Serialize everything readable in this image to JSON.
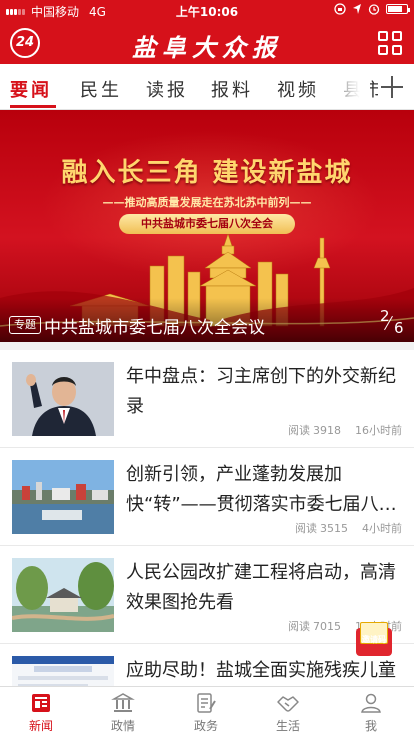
{
  "status_bar": {
    "carrier": "中国移动",
    "network": "4G",
    "time": "上午10:06"
  },
  "header": {
    "logo_text": "24",
    "app_title": "盐阜大众报"
  },
  "tabs": [
    {
      "label": "要闻",
      "active": true
    },
    {
      "label": "民生",
      "active": false
    },
    {
      "label": "读报",
      "active": false
    },
    {
      "label": "报料",
      "active": false
    },
    {
      "label": "视频",
      "active": false
    },
    {
      "label": "县市",
      "active": false
    }
  ],
  "banner": {
    "headline": "融入长三角 建设新盐城",
    "subline": "——推动高质量发展走在苏北苏中前列——",
    "pill": "中共盐城市委七届八次全会",
    "tag": "专题",
    "caption": "中共盐城市委七届八次全会议",
    "page_current": "2",
    "page_total": "6"
  },
  "news": [
    {
      "headline": "年中盘点：习主席创下的外交新纪录",
      "reads_label": "阅读",
      "reads": "3918",
      "time": "16小时前"
    },
    {
      "headline": "创新引领，产业蓬勃发展加快“转”——贯彻落实市委七届八次全会精神",
      "reads_label": "阅读",
      "reads": "3515",
      "time": "4小时前"
    },
    {
      "headline": "人民公园改扩建工程将启动，高清效果图抢先看",
      "reads_label": "阅读",
      "reads": "7015",
      "time": "16小时前"
    },
    {
      "headline": "应助尽助！盐城全面实施残疾儿童康复救助制度",
      "reads_label": "阅读",
      "reads": "",
      "time": ""
    }
  ],
  "floating_button": {
    "label": "邀请码"
  },
  "bottom_tabs": [
    {
      "label": "新闻",
      "active": true
    },
    {
      "label": "政情",
      "active": false
    },
    {
      "label": "政务",
      "active": false
    },
    {
      "label": "生活",
      "active": false
    },
    {
      "label": "我",
      "active": false
    }
  ],
  "colors": {
    "brand_red": "#d6111a",
    "text_dark": "#222222",
    "meta_gray": "#999999"
  }
}
